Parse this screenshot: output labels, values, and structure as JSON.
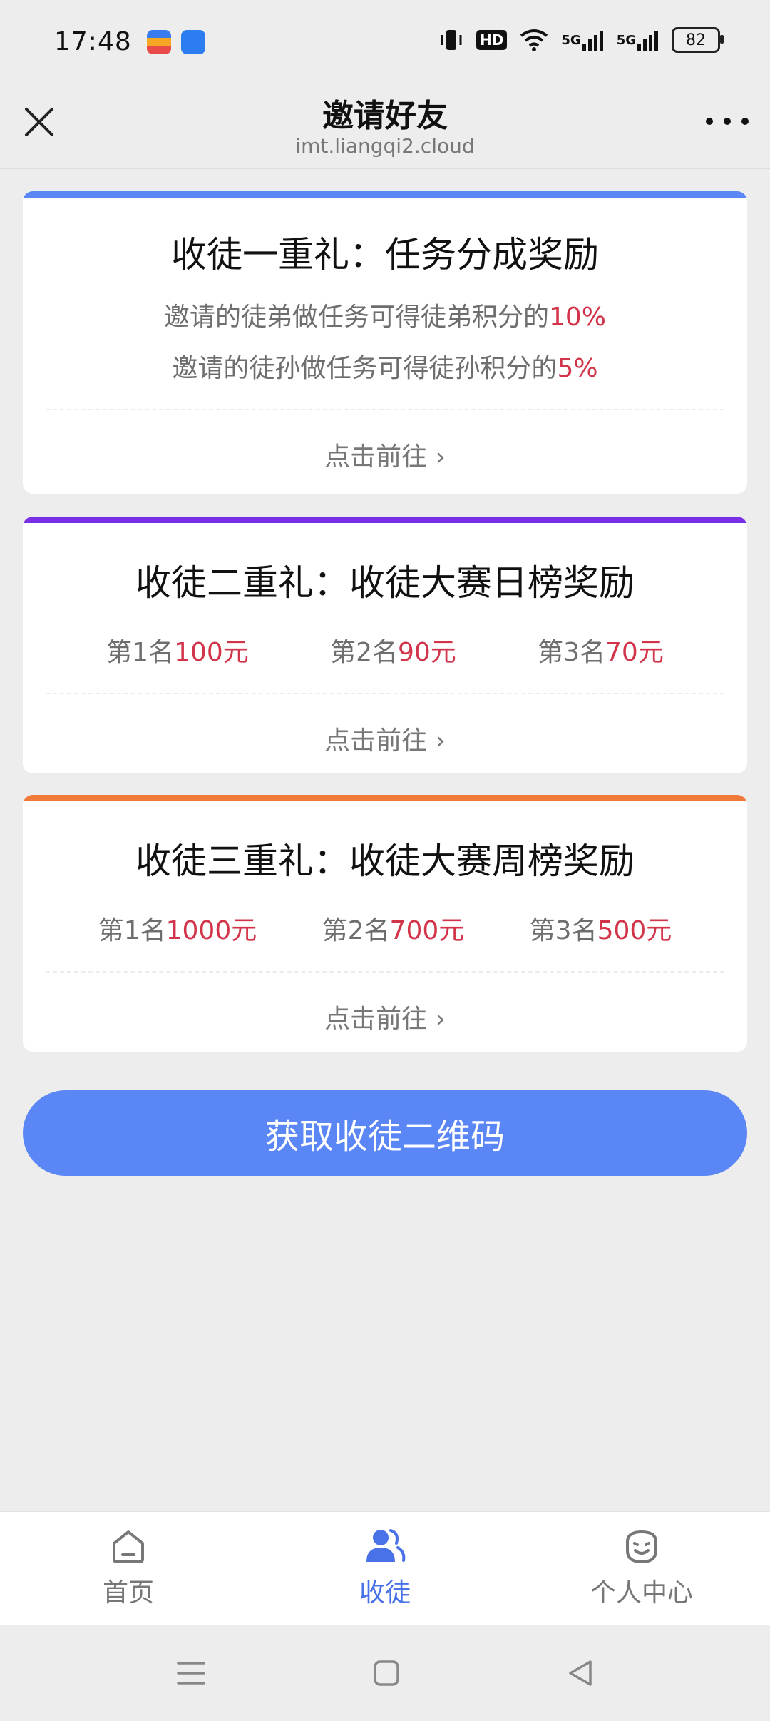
{
  "status_bar": {
    "time": "17:48",
    "signal_1": "5G",
    "signal_2": "5G",
    "hd_label": "HD",
    "battery": "82"
  },
  "header": {
    "title": "邀请好友",
    "subtitle": "imt.liangqi2.cloud"
  },
  "cards": [
    {
      "accent": "#5b86f5",
      "title": "收徒一重礼：任务分成奖励",
      "lines": [
        {
          "text": "邀请的徒弟做任务可得徒弟积分的",
          "highlight": "10%"
        },
        {
          "text": "邀请的徒孙做任务可得徒孙积分的",
          "highlight": "5%"
        }
      ],
      "link": "点击前往 ›"
    },
    {
      "accent": "#7a2ee6",
      "title": "收徒二重礼：收徒大赛日榜奖励",
      "ranks": [
        {
          "label": "第1名",
          "prize": "100元"
        },
        {
          "label": "第2名",
          "prize": "90元"
        },
        {
          "label": "第3名",
          "prize": "70元"
        }
      ],
      "link": "点击前往 ›"
    },
    {
      "accent": "#f07a3a",
      "title": "收徒三重礼：收徒大赛周榜奖励",
      "ranks": [
        {
          "label": "第1名",
          "prize": "1000元"
        },
        {
          "label": "第2名",
          "prize": "700元"
        },
        {
          "label": "第3名",
          "prize": "500元"
        }
      ],
      "link": "点击前往 ›"
    }
  ],
  "main_button": "获取收徒二维码",
  "tabs": [
    {
      "label": "首页",
      "icon": "home-icon",
      "active": false
    },
    {
      "label": "收徒",
      "icon": "users-icon",
      "active": true
    },
    {
      "label": "个人中心",
      "icon": "smile-icon",
      "active": false
    }
  ],
  "colors": {
    "accent_blue": "#5b86f5",
    "highlight_red": "#d2344a",
    "active_tab": "#4a72e8"
  }
}
